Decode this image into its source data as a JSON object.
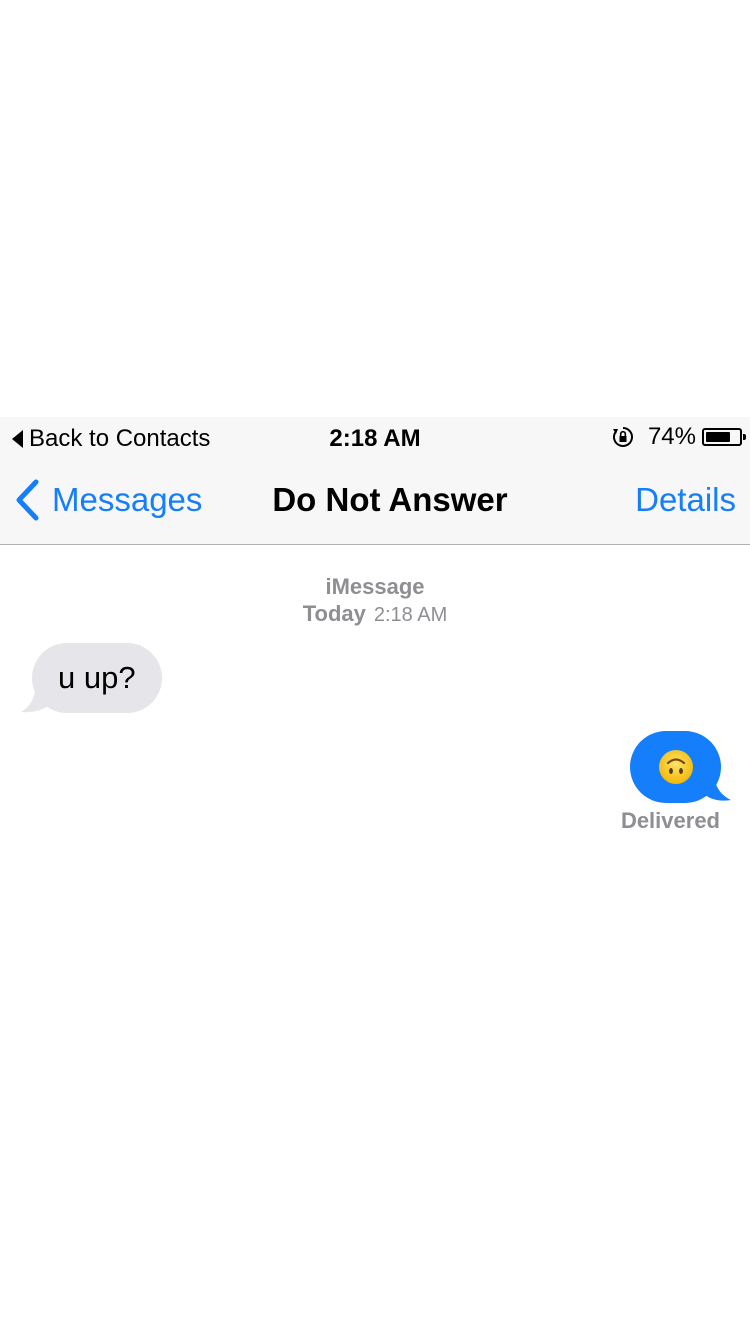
{
  "status_bar": {
    "back_label": "Back to Contacts",
    "time": "2:18 AM",
    "battery_text": "74%",
    "battery_level": 0.74,
    "orientation_lock_icon": "orientation-lock-icon"
  },
  "nav": {
    "back_label": "Messages",
    "title": "Do Not Answer",
    "details_label": "Details"
  },
  "conversation": {
    "service": "iMessage",
    "date_day": "Today",
    "date_time": "2:18 AM",
    "messages": [
      {
        "direction": "incoming",
        "text": "u up?"
      },
      {
        "direction": "outgoing",
        "emoji": "upside-down-face-emoji"
      }
    ],
    "status": "Delivered"
  },
  "colors": {
    "ios_blue": "#147efb",
    "incoming_bubble": "#e5e5ea",
    "meta_gray": "#8e8e93",
    "bar_bg": "#f7f7f7"
  }
}
